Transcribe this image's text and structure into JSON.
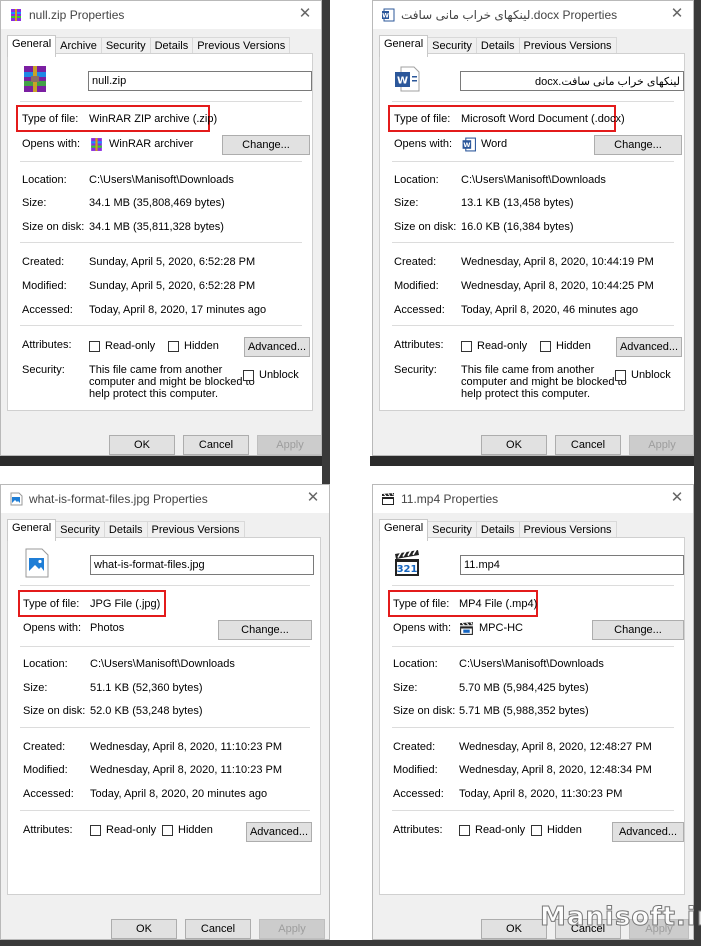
{
  "labels": {
    "type_of_file": "Type of file:",
    "opens_with": "Opens with:",
    "location": "Location:",
    "size": "Size:",
    "size_on_disk": "Size on disk:",
    "created": "Created:",
    "modified": "Modified:",
    "accessed": "Accessed:",
    "attributes": "Attributes:",
    "security": "Security:"
  },
  "buttons": {
    "change": "Change...",
    "advanced": "Advanced...",
    "ok": "OK",
    "cancel": "Cancel",
    "apply": "Apply"
  },
  "checkboxes": {
    "read_only": "Read-only",
    "hidden": "Hidden",
    "unblock": "Unblock"
  },
  "security_text": [
    "This file came from another",
    "computer and might be blocked to",
    "help protect this computer."
  ],
  "watermark": "Manisoft.ir",
  "colors": {
    "highlight": "#e31b1b",
    "window_bg": "#f0f0f0",
    "disabled_text": "#9d9d9d"
  },
  "dialogs": [
    {
      "title": "null.zip Properties",
      "tabs": [
        "General",
        "Archive",
        "Security",
        "Details",
        "Previous Versions"
      ],
      "file_icon": "winrar-archive-icon",
      "file_name": "null.zip",
      "type": "WinRAR ZIP archive (.zip)",
      "opens_with": "WinRAR archiver",
      "opens_with_icon": "winrar-icon",
      "location": "C:\\Users\\Manisoft\\Downloads",
      "size": "34.1 MB (35,808,469 bytes)",
      "size_on_disk": "34.1 MB (35,811,328 bytes)",
      "created": "Sunday, April 5, 2020, 6:52:28 PM",
      "modified": "Sunday, April 5, 2020, 6:52:28 PM",
      "accessed": "Today, April 8, 2020, 17 minutes ago"
    },
    {
      "title": "لینکهای خراب مانی سافت.docx Properties",
      "tabs": [
        "General",
        "Security",
        "Details",
        "Previous Versions"
      ],
      "file_icon": "word-document-icon",
      "file_name": "لینکهای خراب مانی سافت.docx",
      "type": "Microsoft Word Document (.docx)",
      "opens_with": "Word",
      "opens_with_icon": "word-icon",
      "location": "C:\\Users\\Manisoft\\Downloads",
      "size": "13.1 KB (13,458 bytes)",
      "size_on_disk": "16.0 KB (16,384 bytes)",
      "created": "Wednesday, April 8, 2020, 10:44:19 PM",
      "modified": "Wednesday, April 8, 2020, 10:44:25 PM",
      "accessed": "Today, April 8, 2020, 46 minutes ago"
    },
    {
      "title": "what-is-format-files.jpg Properties",
      "tabs": [
        "General",
        "Security",
        "Details",
        "Previous Versions"
      ],
      "file_icon": "image-file-icon",
      "file_name": "what-is-format-files.jpg",
      "type": "JPG File (.jpg)",
      "opens_with": "Photos",
      "location": "C:\\Users\\Manisoft\\Downloads",
      "size": "51.1 KB (52,360 bytes)",
      "size_on_disk": "52.0 KB (53,248 bytes)",
      "created": "Wednesday, April 8, 2020, 11:10:23 PM",
      "modified": "Wednesday, April 8, 2020, 11:10:23 PM",
      "accessed": "Today, April 8, 2020, 20 minutes ago"
    },
    {
      "title": "11.mp4 Properties",
      "tabs": [
        "General",
        "Security",
        "Details",
        "Previous Versions"
      ],
      "file_icon": "mpc-clapperboard-icon",
      "file_name": "11.mp4",
      "type": "MP4 File (.mp4)",
      "opens_with": "MPC-HC",
      "opens_with_icon": "mpc-hc-icon",
      "location": "C:\\Users\\Manisoft\\Downloads",
      "size": "5.70 MB (5,984,425 bytes)",
      "size_on_disk": "5.71 MB (5,988,352 bytes)",
      "created": "Wednesday, April 8, 2020, 12:48:27 PM",
      "modified": "Wednesday, April 8, 2020, 12:48:34 PM",
      "accessed": "Today, April 8, 2020, 11:30:23 PM"
    }
  ]
}
